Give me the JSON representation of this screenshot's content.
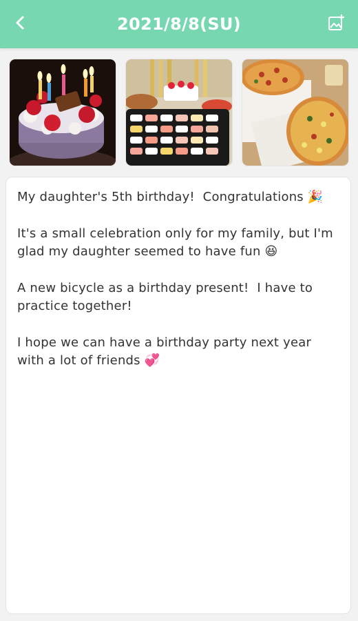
{
  "header": {
    "title": "2021/8/8(SU)",
    "bg_color": "#77d7b0",
    "back_icon": "chevron-left-icon",
    "add_icon": "add-photo-icon"
  },
  "photos": [
    {
      "subject": "birthday cake with candles"
    },
    {
      "subject": "party table with sushi and cake"
    },
    {
      "subject": "pizzas on a table"
    }
  ],
  "entry": {
    "paragraphs": [
      {
        "text": "My daughter's 5th birthday!  Congratulations ",
        "emoji": "🎉"
      },
      {
        "text": "It's a small celebration only for my family, but I'm glad my daughter seemed to have fun ",
        "emoji": "😆"
      },
      {
        "text": "A new bicycle as a birthday present!  I have to practice together!",
        "emoji": ""
      },
      {
        "text": "I hope we can have a birthday party next year with a lot of friends ",
        "emoji": "💞"
      }
    ]
  }
}
